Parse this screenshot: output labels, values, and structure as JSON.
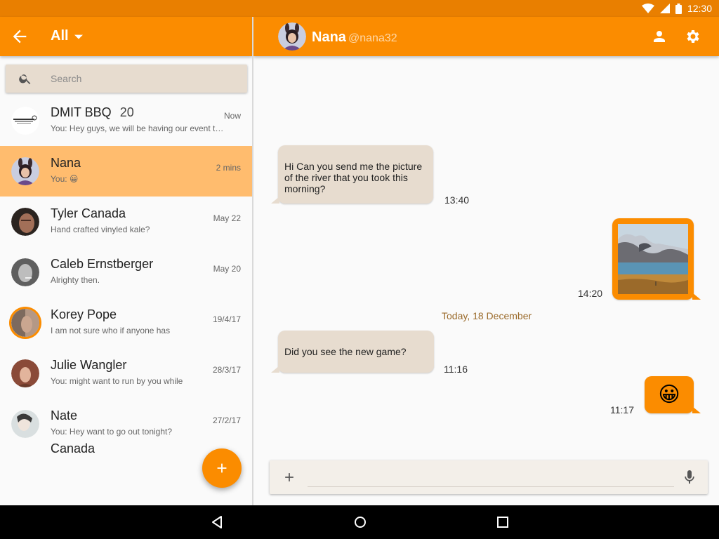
{
  "status_bar": {
    "time": "12:30"
  },
  "left_bar": {
    "filter_label": "All"
  },
  "search": {
    "placeholder": "Search"
  },
  "conversations": [
    {
      "name": "DMIT BBQ",
      "count": "20",
      "preview": "You: Hey guys, we will be having our event to...",
      "time": "Now"
    },
    {
      "name": "Nana",
      "preview": "You: 😀",
      "time": "2 mins"
    },
    {
      "name": "Tyler Canada",
      "preview": "Hand crafted vinyled kale?",
      "time": "May 22"
    },
    {
      "name": "Caleb Ernstberger",
      "preview": "Alrighty then.",
      "time": "May 20"
    },
    {
      "name": "Korey Pope",
      "preview": "I am not sure who if anyone has",
      "time": "19/4/17"
    },
    {
      "name": "Julie Wangler",
      "preview": "You: might want to run by you while",
      "time": "28/3/17"
    },
    {
      "name": "Nate",
      "name_extra": "Canada",
      "preview": "You: Hey want to go out tonight?",
      "time": "27/2/17"
    }
  ],
  "chat_header": {
    "name": "Nana",
    "handle": "@nana32"
  },
  "messages": [
    {
      "text": "Hi Can you send me the picture of the river that you took this morning?",
      "time": "13:40"
    },
    {
      "time": "14:20"
    },
    {
      "date_separator": "Today, 18 December"
    },
    {
      "text": "Did you see the new game?",
      "time": "11:16"
    },
    {
      "emoji": "😀",
      "time": "11:17"
    }
  ],
  "colors": {
    "primary": "#fb8c00",
    "primary_dark": "#e97f00",
    "selected": "#ffbc6e",
    "incoming_bubble": "#e7dccf"
  }
}
